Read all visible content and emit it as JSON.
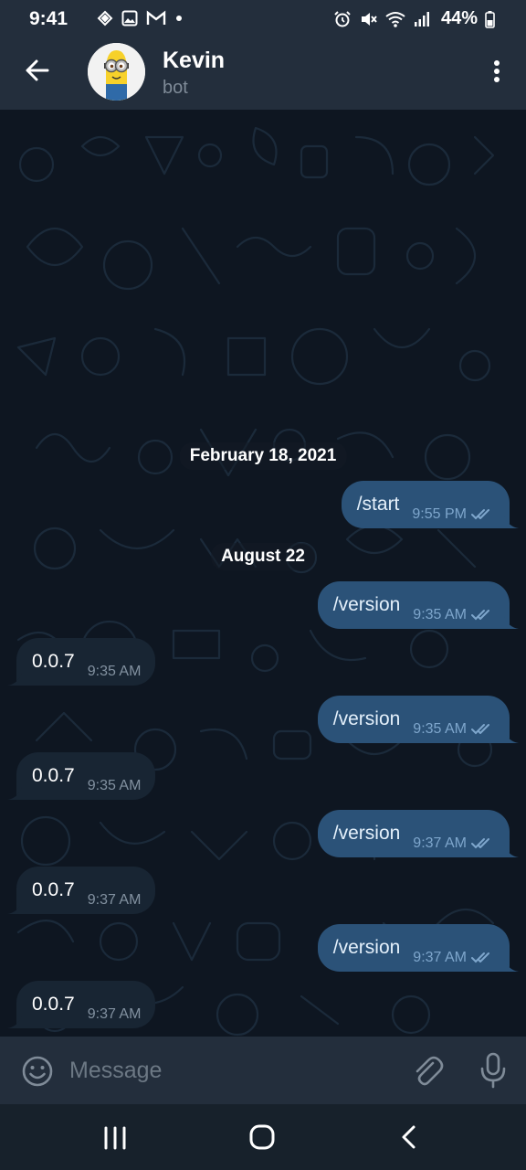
{
  "status_bar": {
    "time": "9:41",
    "battery": "44%",
    "left_icons": [
      "binance-icon",
      "gallery-icon",
      "gmail-icon",
      "dot-icon"
    ],
    "right_icons": [
      "alarm-icon",
      "mute-icon",
      "wifi-icon",
      "signal-icon",
      "battery-icon"
    ]
  },
  "header": {
    "title": "Kevin",
    "subtitle": "bot",
    "avatar": "minion-avatar"
  },
  "chat": {
    "date_1": "February 18, 2021",
    "date_2": "August 22",
    "messages": [
      {
        "dir": "out",
        "text": "/start",
        "time": "9:55 PM"
      },
      {
        "dir": "out",
        "text": "/version",
        "time": "9:35 AM"
      },
      {
        "dir": "in",
        "text": "0.0.7",
        "time": "9:35 AM"
      },
      {
        "dir": "out",
        "text": "/version",
        "time": "9:35 AM"
      },
      {
        "dir": "in",
        "text": "0.0.7",
        "time": "9:35 AM"
      },
      {
        "dir": "out",
        "text": "/version",
        "time": "9:37 AM"
      },
      {
        "dir": "in",
        "text": "0.0.7",
        "time": "9:37 AM"
      },
      {
        "dir": "out",
        "text": "/version",
        "time": "9:37 AM"
      },
      {
        "dir": "in",
        "text": "0.0.7",
        "time": "9:37 AM"
      }
    ]
  },
  "input": {
    "placeholder": "Message"
  },
  "colors": {
    "chat_bg": "#0e1621",
    "header_bg": "#232e3c",
    "outgoing_bubble": "#2b5278",
    "incoming_bubble": "#182533"
  }
}
